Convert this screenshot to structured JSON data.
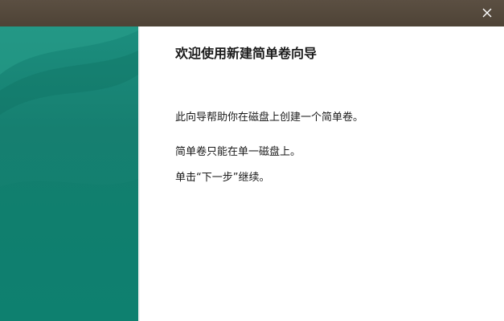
{
  "window": {
    "title": "",
    "close_icon": "close-icon",
    "titlebar_color": "#524638",
    "side_panel_color": "#138474"
  },
  "wizard": {
    "heading": "欢迎使用新建简单卷向导",
    "paragraphs": [
      "此向导帮助你在磁盘上创建一个简单卷。",
      "简单卷只能在单一磁盘上。",
      "单击“下一步”继续。"
    ]
  }
}
